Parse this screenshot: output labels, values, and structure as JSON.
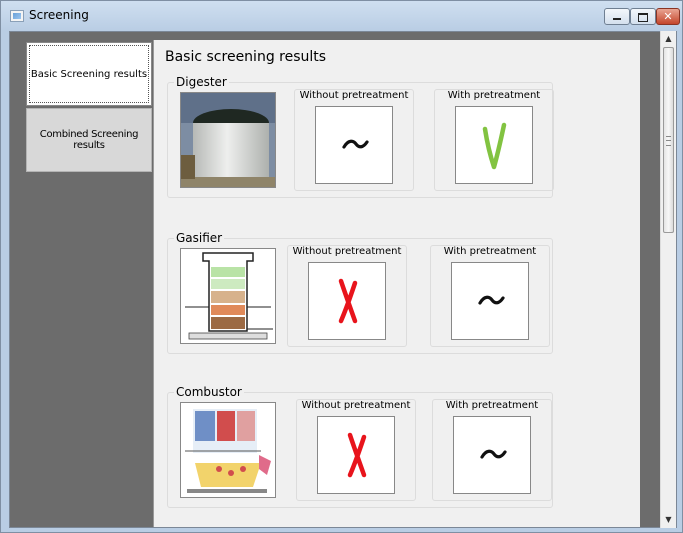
{
  "window": {
    "title": "Screening",
    "close_glyph": "✕"
  },
  "tabs": [
    {
      "label": "Basic Screening results",
      "active": true
    },
    {
      "label": "Combined Screening results",
      "active": false
    }
  ],
  "content": {
    "heading": "Basic screening results",
    "groups": [
      {
        "title": "Digester",
        "image": "digester-photo",
        "without_label": "Without pretreatment",
        "without_result": "~",
        "with_label": "With pretreatment",
        "with_result": "V"
      },
      {
        "title": "Gasifier",
        "image": "gasifier-diagram",
        "without_label": "Without pretreatment",
        "without_result": "X",
        "with_label": "With pretreatment",
        "with_result": "~"
      },
      {
        "title": "Combustor",
        "image": "combustor-diagram",
        "without_label": "Without pretreatment",
        "without_result": "X",
        "with_label": "With pretreatment",
        "with_result": "~"
      }
    ]
  },
  "result_colors": {
    "ok": "#82c341",
    "fail": "#e8141c",
    "neutral": "#111111"
  },
  "scrollbar": {
    "up_glyph": "▲",
    "down_glyph": "▼"
  }
}
